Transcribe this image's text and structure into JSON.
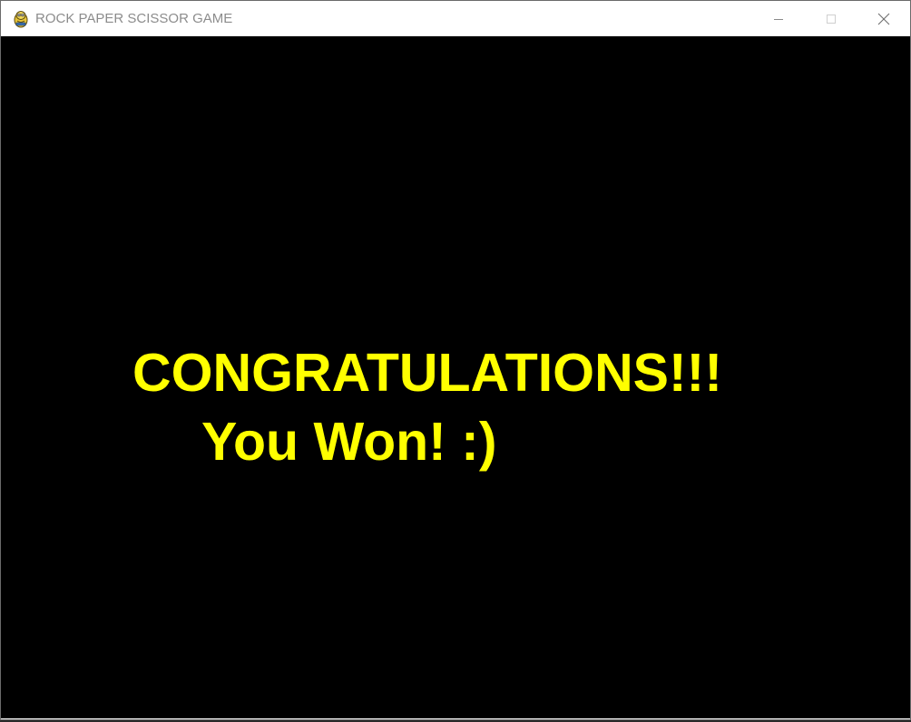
{
  "window": {
    "title": "ROCK PAPER SCISSOR GAME",
    "app_icon": "pygame-snake-icon",
    "controls": {
      "minimize": "minimize-icon",
      "maximize": "maximize-icon",
      "close": "close-icon"
    }
  },
  "game": {
    "background_color": "#000000",
    "text_color": "#ffff00",
    "headline": "CONGRATULATIONS!!!",
    "message": "You Won! :)"
  }
}
